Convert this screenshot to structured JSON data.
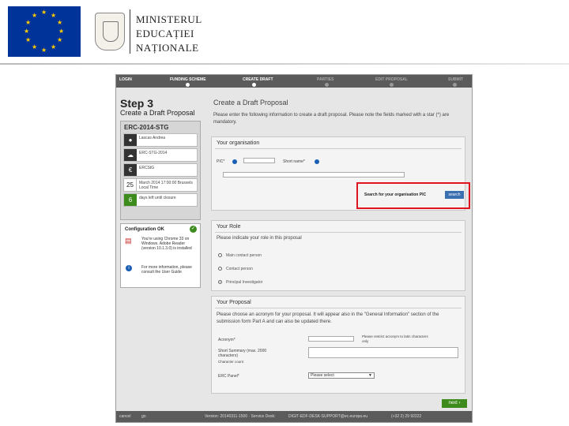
{
  "slide": {
    "ministry_lines": [
      "MINISTERUL",
      "EDUCAȚIEI",
      "NAȚIONALE"
    ],
    "eu_flag_color": "#003399",
    "eu_star_color": "#ffcc00",
    "highlight_color": "#e0141e"
  },
  "wizard": {
    "steps": [
      "LOGIN",
      "FUNDING SCHEME",
      "CREATE DRAFT",
      "PARTIES",
      "EDIT PROPOSAL",
      "SUBMIT"
    ],
    "current_step": "CREATE DRAFT",
    "step_title": "Step 3",
    "step_subtitle": "Create a Draft Proposal"
  },
  "left_panel": {
    "call_id": "ERC-2014-STG",
    "rows": [
      {
        "icon": "user-icon",
        "text": "Lascas Andrea"
      },
      {
        "icon": "cloud-icon",
        "text": "ERC-STG-2014"
      },
      {
        "icon": "euro-icon",
        "text": "ERCStG"
      },
      {
        "icon": "calendar-icon",
        "icon_text": "25",
        "text": "March 2014 17:00:00 Brussels Local Time"
      },
      {
        "icon": "days-icon",
        "icon_text": "6",
        "text": "days left until closure"
      }
    ]
  },
  "config": {
    "title": "Configuration OK",
    "browser_note": "You're using Chrome 33 on Windows. Adobe Reader (version 10.1.3.0) is installed",
    "help_note": "For more information, please consult the User Guide"
  },
  "main": {
    "title": "Create a Draft Proposal",
    "intro": "Please enter the following information to create a draft proposal. Please note the fields marked with a star (*) are mandatory.",
    "organisation": {
      "title": "Your organisation",
      "pic_label": "PIC*",
      "short_name_label": "Short name*",
      "search_label": "Search for your organisation PIC",
      "search_button": "search"
    },
    "role": {
      "title": "Your Role",
      "prompt": "Please indicate your role in this proposal",
      "options": [
        "Main contact person",
        "Contact person",
        "Principal Investigator"
      ],
      "selected": 2
    },
    "proposal": {
      "title": "Your Proposal",
      "intro": "Please choose an acronym for your proposal. It will appear also in the \"General Information\" section of the submission form Part A and can also be updated there.",
      "acronym_label": "Acronym*",
      "acronym_hint": "Please restrict acronym to latin characters only",
      "summary_label": "Short Summary (max. 2000 characters)",
      "summary_count": "Character count",
      "panel_label": "ERC Panel*",
      "panel_value": "Please select"
    },
    "next_button": "next ›"
  },
  "footer": {
    "cancel": "cancel",
    "go": "go",
    "version": "Version: 20140311-1500 · Service Desk:",
    "desk_email": "DIGIT-EDF-DESK-SUPPORT@ec.europa.eu",
    "phone": "(+32 2) 29 92222"
  }
}
